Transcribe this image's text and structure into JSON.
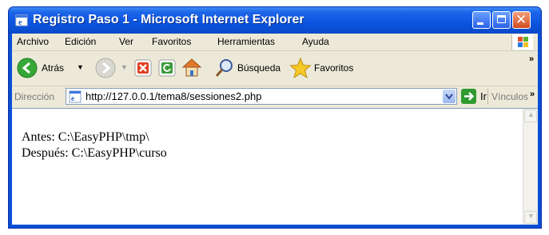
{
  "window": {
    "title": "Registro Paso 1 - Microsoft Internet Explorer"
  },
  "menu": {
    "items": [
      "Archivo",
      "Edición",
      "Ver",
      "Favoritos",
      "Herramientas",
      "Ayuda"
    ]
  },
  "toolbar": {
    "back_label": "Atrás",
    "search_label": "Búsqueda",
    "favorites_label": "Favoritos",
    "overflow": "»"
  },
  "address": {
    "label": "Dirección",
    "url": "http://127.0.0.1/tema8/sessiones2.php",
    "go_label": "Ir",
    "links_label": "Vínculos",
    "links_overflow": "»"
  },
  "content": {
    "lines": [
      "Antes: C:\\EasyPHP\\tmp\\",
      "Después: C:\\EasyPHP\\curso"
    ]
  },
  "colors": {
    "titlebar": "#0b55e0",
    "chrome": "#ece9d8",
    "close_button": "#d24a1f"
  }
}
